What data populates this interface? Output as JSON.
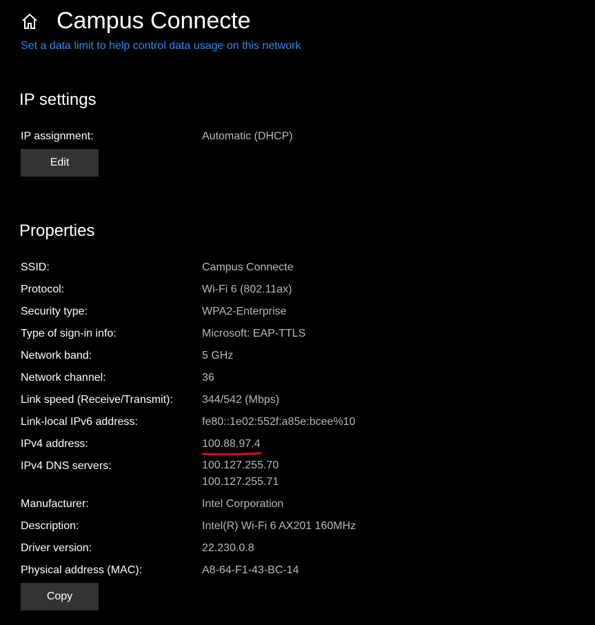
{
  "header": {
    "title": "Campus Connecte",
    "home_icon": "home-icon"
  },
  "data_limit_link": "Set a data limit to help control data usage on this network",
  "ip_settings": {
    "heading": "IP settings",
    "assignment_label": "IP assignment:",
    "assignment_value": "Automatic (DHCP)",
    "edit_label": "Edit"
  },
  "properties": {
    "heading": "Properties",
    "rows": [
      {
        "label": "SSID:",
        "value": "Campus Connecte"
      },
      {
        "label": "Protocol:",
        "value": "Wi-Fi 6 (802.11ax)"
      },
      {
        "label": "Security type:",
        "value": "WPA2-Enterprise"
      },
      {
        "label": "Type of sign-in info:",
        "value": "Microsoft: EAP-TTLS"
      },
      {
        "label": "Network band:",
        "value": "5 GHz"
      },
      {
        "label": "Network channel:",
        "value": "36"
      },
      {
        "label": "Link speed (Receive/Transmit):",
        "value": "344/542 (Mbps)"
      },
      {
        "label": "Link-local IPv6 address:",
        "value": "fe80::1e02:552f:a85e:bcee%10"
      },
      {
        "label": "IPv4 address:",
        "value": "100.88.97.4"
      },
      {
        "label": "IPv4 DNS servers:",
        "values": [
          "100.127.255.70",
          "100.127.255.71"
        ]
      },
      {
        "label": "Manufacturer:",
        "value": "Intel Corporation"
      },
      {
        "label": "Description:",
        "value": "Intel(R) Wi-Fi 6 AX201 160MHz"
      },
      {
        "label": "Driver version:",
        "value": "22.230.0.8"
      },
      {
        "label": "Physical address (MAC):",
        "value": "A8-64-F1-43-BC-14"
      }
    ],
    "copy_label": "Copy"
  },
  "colors": {
    "background": "#000000",
    "link": "#2b8ce8",
    "value_text": "#b9b9b9",
    "button_bg": "#333333",
    "highlight": "#e0101a"
  }
}
